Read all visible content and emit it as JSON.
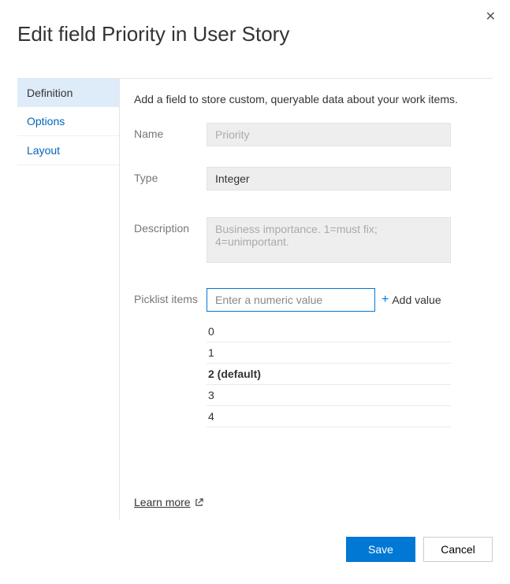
{
  "title": "Edit field Priority in User Story",
  "tabs": {
    "definition": "Definition",
    "options": "Options",
    "layout": "Layout"
  },
  "intro": "Add a field to store custom, queryable data about your work items.",
  "labels": {
    "name": "Name",
    "type": "Type",
    "description": "Description",
    "picklist": "Picklist items"
  },
  "fields": {
    "name_value": "Priority",
    "type_value": "Integer",
    "description_value": "Business importance. 1=must fix; 4=unimportant.",
    "picklist_placeholder": "Enter a numeric value"
  },
  "add_value_label": "Add value",
  "picklist_items": {
    "i0": "0",
    "i1": "1",
    "i2": "2 (default)",
    "i3": "3",
    "i4": "4"
  },
  "learn_more": "Learn more",
  "buttons": {
    "save": "Save",
    "cancel": "Cancel"
  }
}
